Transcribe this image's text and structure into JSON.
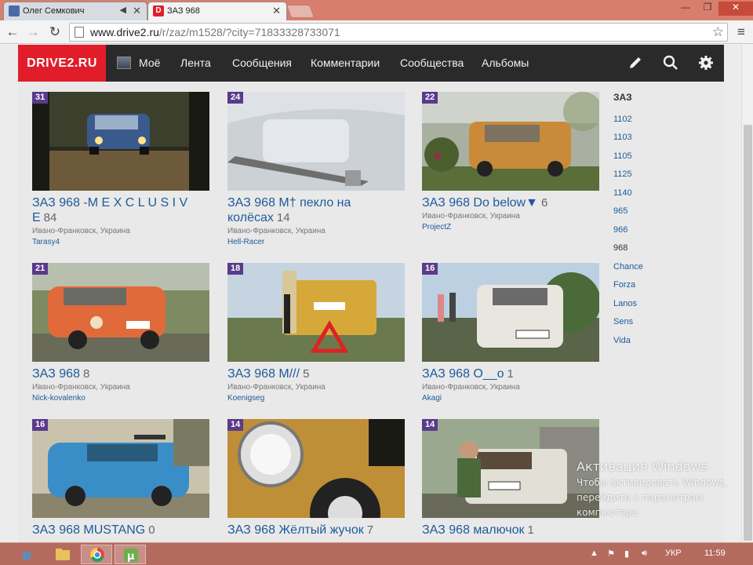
{
  "browser": {
    "tabs": [
      {
        "title": "Олег Семкович",
        "active": false
      },
      {
        "title": "ЗАЗ 968",
        "active": true
      }
    ],
    "url_host": "www.drive2.ru",
    "url_path": "/r/zaz/m1528/?city=71833328733071",
    "window_buttons": {
      "minimize": "—",
      "maximize": "❐",
      "close": "✕"
    }
  },
  "site": {
    "logo": "DRIVE2.RU",
    "nav": [
      "Моё",
      "Лента",
      "Сообщения",
      "Комментарии",
      "Сообщества",
      "Альбомы"
    ],
    "icons": [
      "pencil-icon",
      "search-icon",
      "gear-icon"
    ]
  },
  "cards": [
    {
      "rank": "31",
      "title": "ЗАЗ 968 -M E X C L U S I V E",
      "count": "84",
      "location": "Ивано-Франковск, Украина",
      "user": "Tarasy4"
    },
    {
      "rank": "24",
      "title": "ЗАЗ 968 М† пекло на колёсах",
      "count": "14",
      "location": "Ивано-Франковск, Украина",
      "user": "Hell-Racer"
    },
    {
      "rank": "22",
      "title": "ЗАЗ 968 Do below▼",
      "count": "6",
      "location": "Ивано-Франковск, Украина",
      "user": "ProjectZ"
    },
    {
      "rank": "21",
      "title": "ЗАЗ 968",
      "count": "8",
      "location": "Ивано-Франковск, Украина",
      "user": "Nick-kovalenko"
    },
    {
      "rank": "18",
      "title": "ЗАЗ 968 М///",
      "count": "5",
      "location": "Ивано-Франковск, Украина",
      "user": "Koenigseg"
    },
    {
      "rank": "16",
      "title": "ЗАЗ 968 O__o",
      "count": "1",
      "location": "Ивано-Франковск, Украина",
      "user": "Akagi"
    },
    {
      "rank": "16",
      "title": "ЗАЗ 968 MUSTANG",
      "count": "0",
      "location": "",
      "user": ""
    },
    {
      "rank": "14",
      "title": "ЗАЗ 968 Жёлтый жучок",
      "count": "7",
      "location": "",
      "user": ""
    },
    {
      "rank": "14",
      "title": "ЗАЗ 968 малючок",
      "count": "1",
      "location": "",
      "user": ""
    }
  ],
  "sidebar": {
    "heading": "ЗАЗ",
    "items": [
      "1102",
      "1103",
      "1105",
      "1125",
      "1140",
      "965",
      "966",
      "968",
      "Chance",
      "Forza",
      "Lanos",
      "Sens",
      "Vida"
    ],
    "current": "968"
  },
  "watermark": {
    "title": "Активация Windows",
    "line1": "Чтобы активировать Windows,",
    "line2": "перейдите к параметрам",
    "line3": "компьютера."
  },
  "taskbar": {
    "language": "УКР",
    "time": "11:59"
  },
  "colors": {
    "brand_red": "#e11d2a",
    "header_dark": "#2a2a2a",
    "link_blue": "#1e5a9b",
    "badge_purple": "#5a3a8a"
  }
}
